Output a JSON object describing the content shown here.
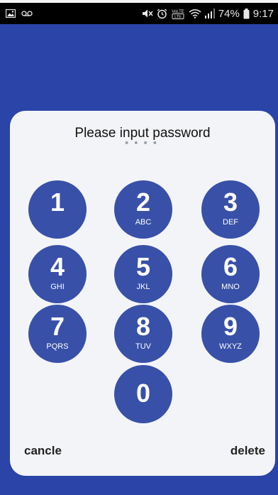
{
  "status_bar": {
    "icons_left": [
      "image-icon",
      "voicemail-icon"
    ],
    "icons_right": [
      "mute-icon",
      "alarm-icon",
      "volte-icon",
      "wifi-icon",
      "signal-icon",
      "battery-icon"
    ],
    "volte_label": "VoLTE",
    "battery": "74%",
    "time": "9:17"
  },
  "dialog": {
    "title": "Please input password",
    "dots": "••••",
    "keys": [
      {
        "digit": "1",
        "letters": ""
      },
      {
        "digit": "2",
        "letters": "ABC"
      },
      {
        "digit": "3",
        "letters": "DEF"
      },
      {
        "digit": "4",
        "letters": "GHI"
      },
      {
        "digit": "5",
        "letters": "JKL"
      },
      {
        "digit": "6",
        "letters": "MNO"
      },
      {
        "digit": "7",
        "letters": "PQRS"
      },
      {
        "digit": "8",
        "letters": "TUV"
      },
      {
        "digit": "9",
        "letters": "WXYZ"
      },
      {
        "digit": "0",
        "letters": ""
      }
    ],
    "cancel_label": "cancle",
    "delete_label": "delete"
  },
  "colors": {
    "background": "#2a44a8",
    "dialog": "#f3f4f7",
    "key": "#3850a8"
  }
}
